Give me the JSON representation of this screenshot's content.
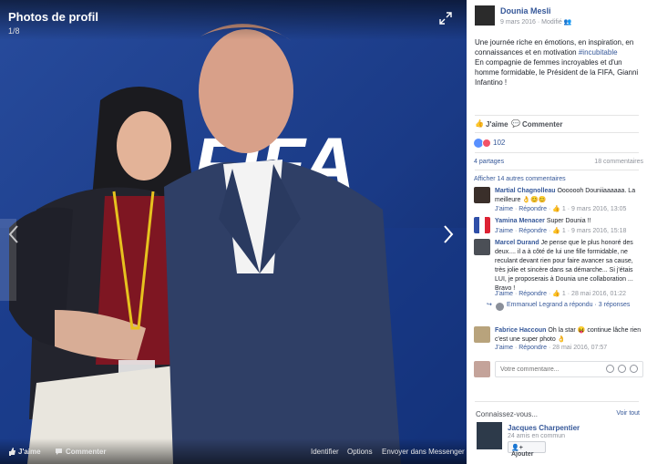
{
  "viewer": {
    "title": "Photos de profil",
    "counter": "1/8",
    "logo_text": "FIFA",
    "bottom": {
      "like": "J'aime",
      "comment": "Commenter",
      "tag": "Identifier",
      "options": "Options",
      "send": "Envoyer dans Messenger"
    }
  },
  "post": {
    "author": "Dounia Mesli",
    "date": "9 mars 2016",
    "edited": "Modifié",
    "text_before": "Une journée riche en émotions, en inspiration, en connaissances et en motivation ",
    "hashtag": "#incubitable",
    "text_after": "En compagnie de femmes incroyables et d'un homme formidable, le Président de la FIFA, Gianni Infantino !"
  },
  "actions": {
    "like": "J'aime",
    "comment": "Commenter"
  },
  "reactions": {
    "count": "102"
  },
  "shares": "4 partages",
  "comments_count": "18 commentaires",
  "more_comments": "Afficher 14 autres commentaires",
  "comments": [
    {
      "name": "Martial Chagnolleau",
      "text": "Ooooooh Douniiaaaaaa. La meilleure 👌😊😊",
      "like": "J'aime",
      "reply": "Répondre",
      "likes": "1",
      "date": "9 mars 2016, 13:05"
    },
    {
      "name": "Yamina Menacer",
      "text": "Super Dounia !!",
      "like": "J'aime",
      "reply": "Répondre",
      "likes": "1",
      "date": "9 mars 2016, 15:18"
    },
    {
      "name": "Marcel Durand",
      "text": "Je pense que le plus honoré des deux.... il a à côté de lui une fille formidable, ne reculant devant rien pour faire avancer sa cause, très jolie et sincère dans sa démarche... Si j'étais LUI, je proposerais à Dounia une collaboration ... Bravo !",
      "like": "J'aime",
      "reply": "Répondre",
      "likes": "1",
      "date": "28 mai 2016, 01:22"
    },
    {
      "name": "Fabrice Haccoun",
      "text": "Oh la star 😝 continue lâche rien c'est une super photo 👌",
      "like": "J'aime",
      "reply": "Répondre",
      "likes": "",
      "date": "28 mai 2016, 07:57"
    }
  ],
  "reply_note": "Emmanuel Legrand a répondu · 3 réponses",
  "write_placeholder": "Votre commentaire...",
  "suggest": {
    "heading": "Connaissez-vous...",
    "see_all": "Voir tout",
    "name": "Jacques Charpentier",
    "mutual": "24 amis en commun",
    "add": "Ajouter"
  }
}
